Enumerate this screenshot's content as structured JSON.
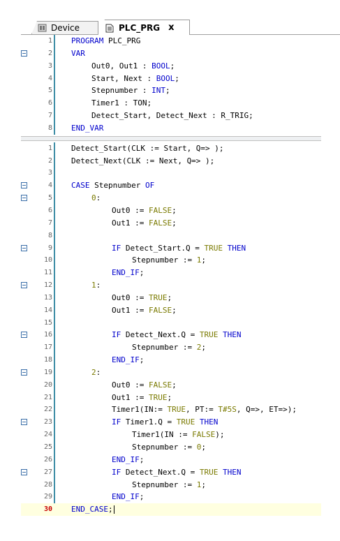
{
  "tabs": {
    "device_label": "Device",
    "plc_label": "PLC_PRG",
    "close_glyph": "x"
  },
  "declaration": [
    {
      "n": "1",
      "fold": false,
      "indent": 0,
      "parts": [
        [
          "kw",
          "PROGRAM"
        ],
        [
          "t",
          " PLC_PRG"
        ]
      ]
    },
    {
      "n": "2",
      "fold": true,
      "indent": 0,
      "parts": [
        [
          "kw",
          "VAR"
        ]
      ]
    },
    {
      "n": "3",
      "fold": false,
      "indent": 1,
      "parts": [
        [
          "t",
          "Out0, Out1 : "
        ],
        [
          "kw",
          "BOOL"
        ],
        [
          "t",
          ";"
        ]
      ]
    },
    {
      "n": "4",
      "fold": false,
      "indent": 1,
      "parts": [
        [
          "t",
          "Start, Next : "
        ],
        [
          "kw",
          "BOOL"
        ],
        [
          "t",
          ";"
        ]
      ]
    },
    {
      "n": "5",
      "fold": false,
      "indent": 1,
      "parts": [
        [
          "t",
          "Stepnumber : "
        ],
        [
          "kw",
          "INT"
        ],
        [
          "t",
          ";"
        ]
      ]
    },
    {
      "n": "6",
      "fold": false,
      "indent": 1,
      "parts": [
        [
          "t",
          "Timer1 : TON;"
        ]
      ]
    },
    {
      "n": "7",
      "fold": false,
      "indent": 1,
      "parts": [
        [
          "t",
          "Detect_Start, Detect_Next : R_TRIG;"
        ]
      ]
    },
    {
      "n": "8",
      "fold": false,
      "indent": 0,
      "parts": [
        [
          "kw",
          "END_VAR"
        ]
      ]
    }
  ],
  "body": [
    {
      "n": "1",
      "fold": false,
      "indent": 0,
      "parts": [
        [
          "t",
          "Detect_Start(CLK := Start, Q=> );"
        ]
      ]
    },
    {
      "n": "2",
      "fold": false,
      "indent": 0,
      "parts": [
        [
          "t",
          "Detect_Next(CLK := Next, Q=> );"
        ]
      ]
    },
    {
      "n": "3",
      "fold": false,
      "indent": 0,
      "parts": []
    },
    {
      "n": "4",
      "fold": true,
      "indent": 0,
      "parts": [
        [
          "kw",
          "CASE"
        ],
        [
          "t",
          " Stepnumber "
        ],
        [
          "kw",
          "OF"
        ]
      ]
    },
    {
      "n": "5",
      "fold": true,
      "indent": 1,
      "parts": [
        [
          "lit",
          "0"
        ],
        [
          "t",
          ":"
        ]
      ]
    },
    {
      "n": "6",
      "fold": false,
      "indent": 2,
      "parts": [
        [
          "t",
          "Out0 := "
        ],
        [
          "lit",
          "FALSE"
        ],
        [
          "t",
          ";"
        ]
      ]
    },
    {
      "n": "7",
      "fold": false,
      "indent": 2,
      "parts": [
        [
          "t",
          "Out1 := "
        ],
        [
          "lit",
          "FALSE"
        ],
        [
          "t",
          ";"
        ]
      ]
    },
    {
      "n": "8",
      "fold": false,
      "indent": 0,
      "parts": []
    },
    {
      "n": "9",
      "fold": true,
      "indent": 2,
      "parts": [
        [
          "kw",
          "IF"
        ],
        [
          "t",
          " Detect_Start.Q = "
        ],
        [
          "lit",
          "TRUE"
        ],
        [
          "t",
          " "
        ],
        [
          "kw",
          "THEN"
        ]
      ]
    },
    {
      "n": "10",
      "fold": false,
      "indent": 3,
      "parts": [
        [
          "t",
          "Stepnumber := "
        ],
        [
          "lit",
          "1"
        ],
        [
          "t",
          ";"
        ]
      ]
    },
    {
      "n": "11",
      "fold": false,
      "indent": 2,
      "parts": [
        [
          "kw",
          "END_IF"
        ],
        [
          "t",
          ";"
        ]
      ]
    },
    {
      "n": "12",
      "fold": true,
      "indent": 1,
      "parts": [
        [
          "lit",
          "1"
        ],
        [
          "t",
          ":"
        ]
      ]
    },
    {
      "n": "13",
      "fold": false,
      "indent": 2,
      "parts": [
        [
          "t",
          "Out0 := "
        ],
        [
          "lit",
          "TRUE"
        ],
        [
          "t",
          ";"
        ]
      ]
    },
    {
      "n": "14",
      "fold": false,
      "indent": 2,
      "parts": [
        [
          "t",
          "Out1 := "
        ],
        [
          "lit",
          "FALSE"
        ],
        [
          "t",
          ";"
        ]
      ]
    },
    {
      "n": "15",
      "fold": false,
      "indent": 0,
      "parts": []
    },
    {
      "n": "16",
      "fold": true,
      "indent": 2,
      "parts": [
        [
          "kw",
          "IF"
        ],
        [
          "t",
          " Detect_Next.Q = "
        ],
        [
          "lit",
          "TRUE"
        ],
        [
          "t",
          " "
        ],
        [
          "kw",
          "THEN"
        ]
      ]
    },
    {
      "n": "17",
      "fold": false,
      "indent": 3,
      "parts": [
        [
          "t",
          "Stepnumber := "
        ],
        [
          "lit",
          "2"
        ],
        [
          "t",
          ";"
        ]
      ]
    },
    {
      "n": "18",
      "fold": false,
      "indent": 2,
      "parts": [
        [
          "kw",
          "END_IF"
        ],
        [
          "t",
          ";"
        ]
      ]
    },
    {
      "n": "19",
      "fold": true,
      "indent": 1,
      "parts": [
        [
          "lit",
          "2"
        ],
        [
          "t",
          ":"
        ]
      ]
    },
    {
      "n": "20",
      "fold": false,
      "indent": 2,
      "parts": [
        [
          "t",
          "Out0 := "
        ],
        [
          "lit",
          "FALSE"
        ],
        [
          "t",
          ";"
        ]
      ]
    },
    {
      "n": "21",
      "fold": false,
      "indent": 2,
      "parts": [
        [
          "t",
          "Out1 := "
        ],
        [
          "lit",
          "TRUE"
        ],
        [
          "t",
          ";"
        ]
      ]
    },
    {
      "n": "22",
      "fold": false,
      "indent": 2,
      "parts": [
        [
          "t",
          "Timer1(IN:= "
        ],
        [
          "lit",
          "TRUE"
        ],
        [
          "t",
          ", PT:= "
        ],
        [
          "lit",
          "T#5S"
        ],
        [
          "t",
          ", Q=>, ET=>);"
        ]
      ]
    },
    {
      "n": "23",
      "fold": true,
      "indent": 2,
      "parts": [
        [
          "kw",
          "IF"
        ],
        [
          "t",
          " Timer1.Q = "
        ],
        [
          "lit",
          "TRUE"
        ],
        [
          "t",
          " "
        ],
        [
          "kw",
          "THEN"
        ]
      ]
    },
    {
      "n": "24",
      "fold": false,
      "indent": 3,
      "parts": [
        [
          "t",
          "Timer1(IN := "
        ],
        [
          "lit",
          "FALSE"
        ],
        [
          "t",
          ");"
        ]
      ]
    },
    {
      "n": "25",
      "fold": false,
      "indent": 3,
      "parts": [
        [
          "t",
          "Stepnumber := "
        ],
        [
          "lit",
          "0"
        ],
        [
          "t",
          ";"
        ]
      ]
    },
    {
      "n": "26",
      "fold": false,
      "indent": 2,
      "parts": [
        [
          "kw",
          "END_IF"
        ],
        [
          "t",
          ";"
        ]
      ]
    },
    {
      "n": "27",
      "fold": true,
      "indent": 2,
      "parts": [
        [
          "kw",
          "IF"
        ],
        [
          "t",
          " Detect_Next.Q = "
        ],
        [
          "lit",
          "TRUE"
        ],
        [
          "t",
          " "
        ],
        [
          "kw",
          "THEN"
        ]
      ]
    },
    {
      "n": "28",
      "fold": false,
      "indent": 3,
      "parts": [
        [
          "t",
          "Stepnumber := "
        ],
        [
          "lit",
          "1"
        ],
        [
          "t",
          ";"
        ]
      ]
    },
    {
      "n": "29",
      "fold": false,
      "indent": 2,
      "parts": [
        [
          "kw",
          "END_IF"
        ],
        [
          "t",
          ";"
        ]
      ]
    },
    {
      "n": "30",
      "fold": false,
      "indent": 0,
      "current": true,
      "parts": [
        [
          "kw",
          "END_CASE"
        ],
        [
          "t",
          ";"
        ]
      ]
    }
  ]
}
